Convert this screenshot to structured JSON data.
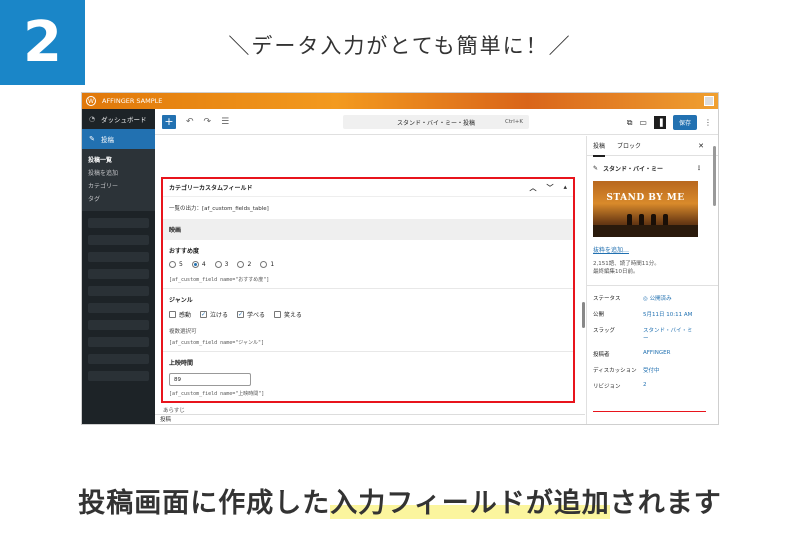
{
  "step_number": "2",
  "headline": "＼データ入力がとても簡単に！／",
  "caption": {
    "before": "投稿画面に作成した",
    "highlight": "入力フィールドが追加",
    "after": "されます"
  },
  "accent_colors": {
    "badge": "#1a86c8",
    "frame": "#e8141c",
    "wp_blue": "#2271b1",
    "highlight": "#fbf59e"
  },
  "admin_bar": {
    "site_name": "AFFINGER SAMPLE"
  },
  "sidebar": {
    "dashboard": "ダッシュボード",
    "posts": "投稿",
    "sub_items": [
      "投稿一覧",
      "投稿を追加",
      "カテゴリー",
      "タグ"
    ]
  },
  "toolbar": {
    "doc_title": "スタンド・バイ・ミー・投稿",
    "shortcut": "Ctrl+K",
    "save_label": "保存"
  },
  "meta_box": {
    "title": "カテゴリーカスタムフィールド",
    "output_text": "一覧の出力：[af_custom_fields_table]",
    "section": "映画",
    "recommend": {
      "label": "おすすめ度",
      "options": [
        "5",
        "4",
        "3",
        "2",
        "1"
      ],
      "selected_index": 1,
      "shortcode": "[af_custom_field name=\"おすすめ度\"]"
    },
    "genre": {
      "label": "ジャンル",
      "options": [
        "感動",
        "泣ける",
        "学べる",
        "笑える"
      ],
      "checked": [
        false,
        true,
        true,
        false
      ],
      "hint": "複数選択可",
      "shortcode": "[af_custom_field name=\"ジャンル\"]"
    },
    "runtime": {
      "label": "上映時間",
      "value": "89",
      "shortcode": "[af_custom_field name=\"上映時間\"]"
    },
    "next_label": "あらすじ"
  },
  "footer_label": "投稿",
  "inspector": {
    "tab_post": "投稿",
    "tab_block": "ブロック",
    "post_title": "スタンド・バイ・ミー",
    "featured_text": "STAND BY ME",
    "excerpt_link": "抜粋を追加…",
    "stats_line1": "2,151語、読了時間11分。",
    "stats_line2": "最終編集10日前。",
    "rows": [
      {
        "key": "ステータス",
        "value": "公開済み"
      },
      {
        "key": "公開",
        "value": "5月11日 10:11 AM"
      },
      {
        "key": "スラッグ",
        "value": "スタンド・バイ・ミー"
      },
      {
        "key": "投稿者",
        "value": "AFFINGER"
      },
      {
        "key": "ディスカッション",
        "value": "受付中"
      },
      {
        "key": "リビジョン",
        "value": "2"
      }
    ]
  }
}
